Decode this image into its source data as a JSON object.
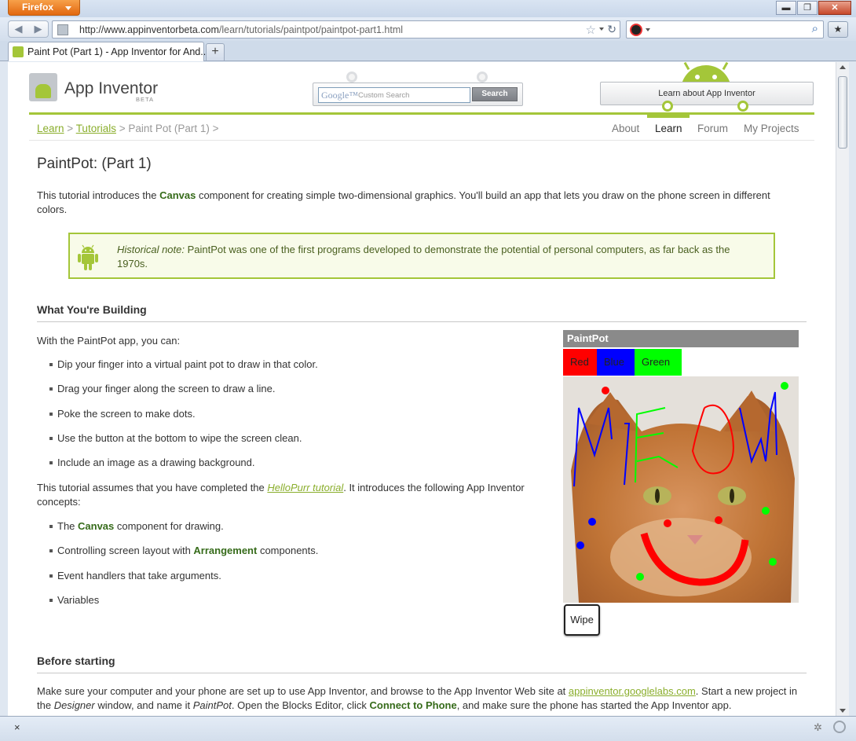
{
  "browser": {
    "app_button": "Firefox",
    "url_host": "http://www.appinventorbeta.com",
    "url_path": "/learn/tutorials/paintpot/paintpot-part1.html",
    "tab_title": "Paint Pot (Part 1) - App Inventor for And...",
    "new_tab": "+",
    "status_close": "×",
    "window_controls": {
      "minimize": "▬",
      "maximize": "❐",
      "close": "✕"
    }
  },
  "header": {
    "logo_text": "App Inventor",
    "logo_beta": "BETA",
    "search_google": "Google™",
    "search_placeholder": "Custom Search",
    "search_button": "Search",
    "learn_about": "Learn about App Inventor",
    "brand_green": "#a4c639"
  },
  "breadcrumb": {
    "learn": "Learn",
    "sep1": " > ",
    "tutorials": "Tutorials",
    "rest": " > Paint Pot (Part 1) >"
  },
  "topnav": [
    "About",
    "Learn",
    "Forum",
    "My Projects"
  ],
  "page": {
    "title": "PaintPot: (Part 1)",
    "intro_pre": "This tutorial introduces the ",
    "intro_bold": "Canvas",
    "intro_post": " component for creating simple two-dimensional graphics. You'll build an app that lets you draw on the phone screen in different colors.",
    "note_label": "Historical note:",
    "note_text": " PaintPot was one of the first programs developed to demonstrate the potential of personal computers, as far back as the 1970s."
  },
  "building": {
    "heading": "What You're Building",
    "lead": "With the PaintPot app, you can:",
    "bullets": [
      "Dip your finger into a virtual paint pot to draw in that color.",
      "Drag your finger along the screen to draw a line.",
      "Poke the screen to make dots.",
      "Use the button at the bottom to wipe the screen clean.",
      "Include an image as a drawing background."
    ],
    "assume_pre": "This tutorial assumes that you have completed the ",
    "assume_link": "HelloPurr tutorial",
    "assume_post": ". It introduces the following App Inventor concepts:",
    "concepts": [
      {
        "pre": "The ",
        "bold": "Canvas",
        "post": " component for drawing."
      },
      {
        "pre": "Controlling screen layout with ",
        "bold": "Arrangement",
        "post": " components."
      },
      {
        "pre": "Event handlers that take arguments.",
        "bold": "",
        "post": ""
      },
      {
        "pre": "Variables",
        "bold": "",
        "post": ""
      }
    ]
  },
  "phone": {
    "app_title": "PaintPot",
    "buttons": [
      {
        "label": "Red",
        "color": "#ff0000"
      },
      {
        "label": "Blue",
        "color": "#0000ff"
      },
      {
        "label": "Green",
        "color": "#00ff00"
      }
    ],
    "wipe": "Wipe"
  },
  "before": {
    "heading": "Before starting",
    "p1": "Make sure your computer and your phone are set up to use App Inventor, and browse to the App Inventor Web site at ",
    "link": "appinventor.googlelabs.com",
    "p2": ". Start a new project in the ",
    "designer": "Designer",
    "p3": " window, and name it ",
    "name": "PaintPot",
    "p4": ". Open the Blocks Editor, click ",
    "connect": "Connect to Phone",
    "p5": ", and make sure the phone has started the App Inventor app."
  }
}
